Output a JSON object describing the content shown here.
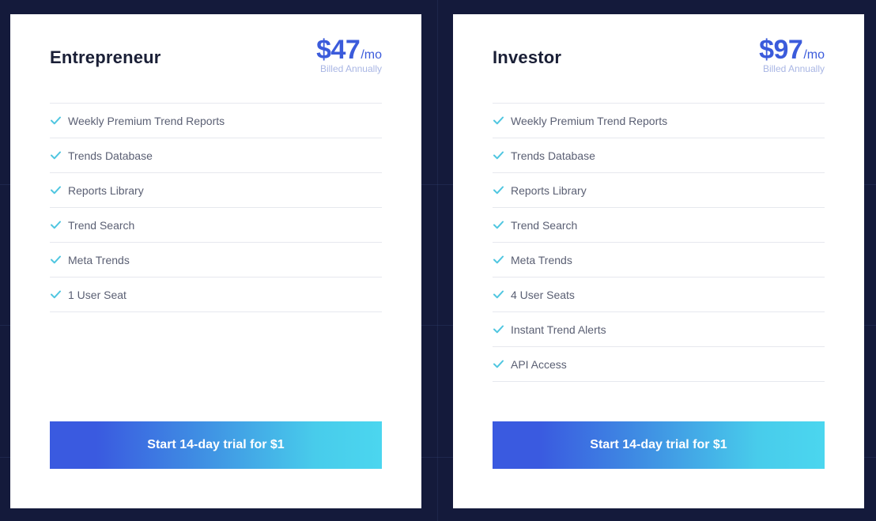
{
  "plans": [
    {
      "name": "Entrepreneur",
      "price": "$47",
      "period": "/mo",
      "billing": "Billed Annually",
      "features": [
        "Weekly Premium Trend Reports",
        "Trends Database",
        "Reports Library",
        "Trend Search",
        "Meta Trends",
        "1 User Seat"
      ],
      "cta_label": "Start 14-day trial for $1"
    },
    {
      "name": "Investor",
      "price": "$97",
      "period": "/mo",
      "billing": "Billed Annually",
      "features": [
        "Weekly Premium Trend Reports",
        "Trends Database",
        "Reports Library",
        "Trend Search",
        "Meta Trends",
        "4 User Seats",
        "Instant Trend Alerts",
        "API Access"
      ],
      "cta_label": "Start 14-day trial for $1"
    }
  ],
  "colors": {
    "background": "#141a3b",
    "accent": "#3b5bdb",
    "check": "#4fc6e0",
    "gradient_start": "#3a5ae0",
    "gradient_end": "#4bd6ef"
  }
}
